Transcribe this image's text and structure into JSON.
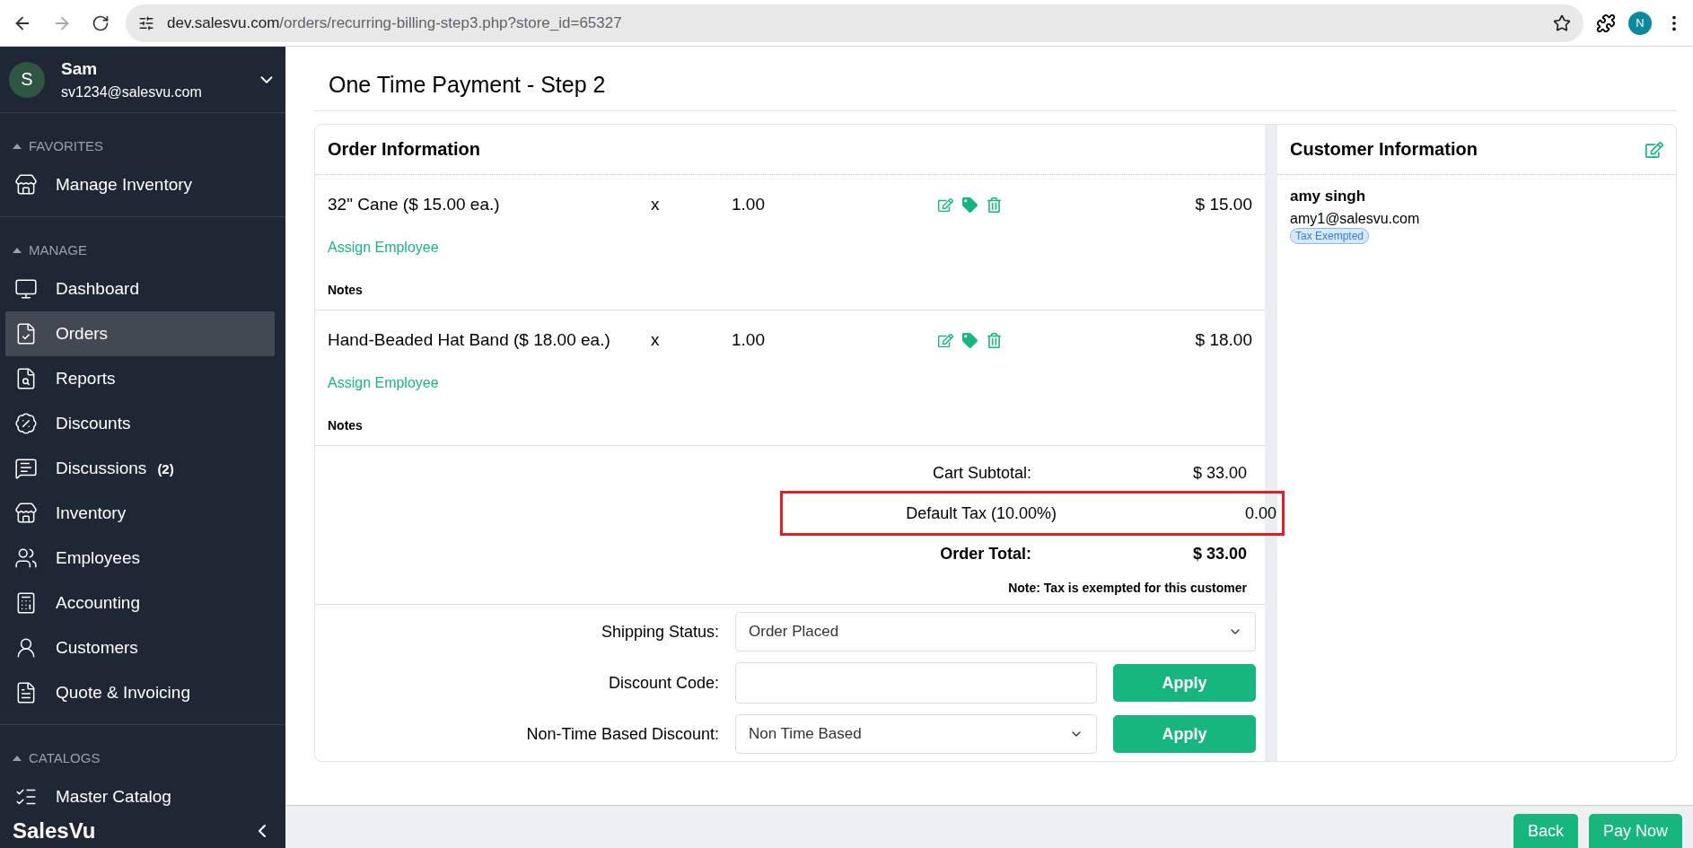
{
  "browser": {
    "url_host": "dev.salesvu.com",
    "url_path": "/orders/recurring-billing-step3.php?store_id=65327",
    "forward_disabled": true,
    "profile": "N"
  },
  "sidebar": {
    "user": {
      "initial": "S",
      "name": "Sam",
      "email": "sv1234@salesvu.com"
    },
    "sections": [
      {
        "title": "FAVORITES",
        "items": [
          {
            "label": "Manage Inventory",
            "selected": false
          }
        ]
      },
      {
        "title": "MANAGE",
        "items": [
          {
            "label": "Dashboard",
            "selected": false
          },
          {
            "label": "Orders",
            "selected": true
          },
          {
            "label": "Reports",
            "selected": false
          },
          {
            "label": "Discounts",
            "selected": false
          },
          {
            "label": "Discussions",
            "badge": "(2)",
            "selected": false
          },
          {
            "label": "Inventory",
            "selected": false
          },
          {
            "label": "Employees",
            "selected": false
          },
          {
            "label": "Accounting",
            "selected": false
          },
          {
            "label": "Customers",
            "selected": false
          },
          {
            "label": "Quote & Invoicing",
            "selected": false
          }
        ]
      },
      {
        "title": "CATALOGS",
        "items": [
          {
            "label": "Master Catalog",
            "selected": false
          }
        ]
      }
    ],
    "logo": "SalesVu"
  },
  "page_title": "One Time Payment - Step 2",
  "order": {
    "title": "Order Information",
    "items": [
      {
        "name": "32\" Cane ($ 15.00 ea.)",
        "times": "x",
        "qty": "1.00",
        "total": "$ 15.00",
        "assign": "Assign Employee",
        "notes": "Notes"
      },
      {
        "name": "Hand-Beaded Hat Band ($ 18.00 ea.)",
        "times": "x",
        "qty": "1.00",
        "total": "$ 18.00",
        "assign": "Assign Employee",
        "notes": "Notes"
      }
    ],
    "totals": [
      {
        "label": "Cart Subtotal:",
        "value": "$ 33.00",
        "bold": false,
        "highlighted": false
      },
      {
        "label": "Default Tax  (10.00%)",
        "value": "0.00",
        "bold": false,
        "highlighted": true
      },
      {
        "label": "Order Total:",
        "value": "$ 33.00",
        "bold": true,
        "highlighted": false
      }
    ],
    "note": "Note: Tax is exempted for this customer",
    "form": [
      {
        "kind": "select",
        "label": "Shipping Status:",
        "value": "Order Placed"
      },
      {
        "kind": "input",
        "label": "Discount Code:",
        "button": "Apply"
      },
      {
        "kind": "select",
        "label": "Non-Time Based Discount:",
        "value": "Non Time Based",
        "button": "Apply"
      }
    ]
  },
  "customer": {
    "title": "Customer Information",
    "name": "amy singh",
    "email": "amy1@salesvu.com",
    "badge": "Tax Exempted"
  },
  "footer": {
    "buttons": [
      "Back",
      "Pay Now"
    ]
  }
}
